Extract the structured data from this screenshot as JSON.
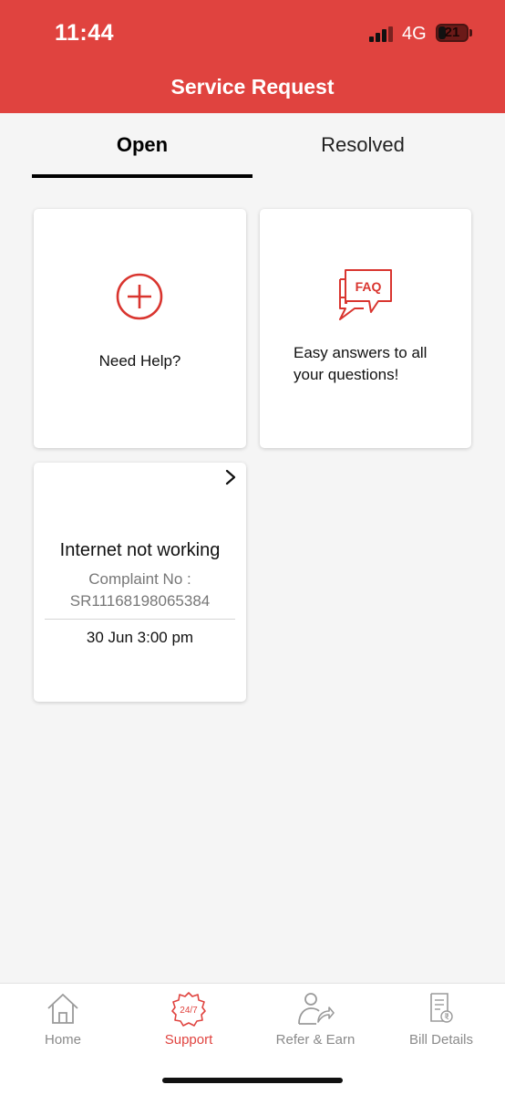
{
  "status_bar": {
    "time": "11:44",
    "network": "4G",
    "battery": "21"
  },
  "header": {
    "title": "Service Request",
    "color": "#e0433f"
  },
  "tabs": [
    {
      "label": "Open",
      "active": true
    },
    {
      "label": "Resolved",
      "active": false
    }
  ],
  "cards": {
    "help": {
      "label": "Need Help?",
      "icon": "plus-circle-icon"
    },
    "faq": {
      "icon_text": "FAQ",
      "label": "Easy answers to all your questions!",
      "icon": "faq-chat-icon"
    },
    "complaint": {
      "title": "Internet not working",
      "number_label": "Complaint No :",
      "number": "SR11168198065384",
      "date": "30 Jun 3:00 pm"
    }
  },
  "bottom_nav": [
    {
      "label": "Home",
      "icon": "home-icon",
      "active": false
    },
    {
      "label": "Support",
      "icon": "support-247-icon",
      "icon_text": "24/7",
      "active": true
    },
    {
      "label": "Refer & Earn",
      "icon": "refer-earn-icon",
      "active": false
    },
    {
      "label": "Bill Details",
      "icon": "bill-icon",
      "active": false
    }
  ]
}
